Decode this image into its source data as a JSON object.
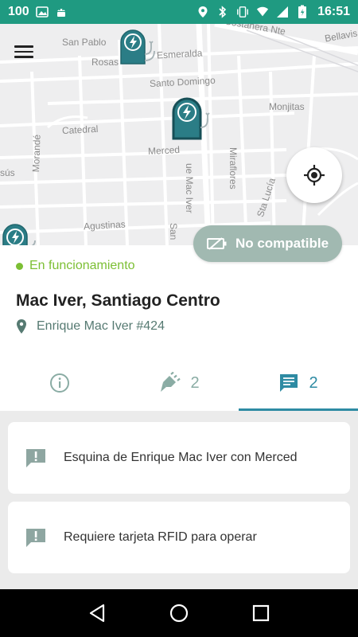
{
  "status_bar": {
    "battery_saver": "100",
    "time": "16:51"
  },
  "map": {
    "streets": {
      "san_pablo": "San Pablo",
      "rosas": "Rosas",
      "esmeralda": "Esmeralda",
      "santo_domingo": "Santo Domingo",
      "monjitas": "Monjitas",
      "catedral": "Catedral",
      "merced": "Merced",
      "morande": "Morandé",
      "mac_iver": "ue Mac Iver",
      "miraflores": "Miraflores",
      "santa_lucia": "Sta Lucía",
      "agustinas": "Agustinas",
      "san": "San",
      "husfanos": "sús",
      "compania": "Costanera Nte",
      "bellavista": "Bellavis"
    }
  },
  "badge": {
    "label": "No compatible"
  },
  "station": {
    "status": "En funcionamiento",
    "title": "Mac Iver, Santiago Centro",
    "address": "Enrique Mac Iver #424"
  },
  "tabs": {
    "info_label": "",
    "connectors_count": "2",
    "comments_count": "2"
  },
  "comments": [
    {
      "text": "Esquina de Enrique Mac Iver con Merced"
    },
    {
      "text": "Requiere tarjeta RFID para operar"
    }
  ],
  "colors": {
    "brand": "#1f9a81",
    "accent": "#2e8ba3",
    "status_ok": "#7cbf34",
    "badge": "#a1b9b1"
  }
}
